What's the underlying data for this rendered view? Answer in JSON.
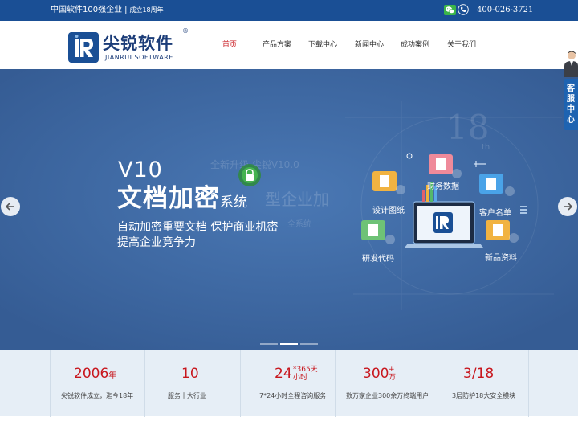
{
  "topbar": {
    "slogan": "中国软件100强企业",
    "divider": "|",
    "years": "成立18周年",
    "phone": "400-026-3721",
    "icons": {
      "wechat": "wechat-icon",
      "phone": "phone-icon"
    }
  },
  "header": {
    "logo_cn": "尖锐软件",
    "logo_en": "JIANRUI SOFTWARE",
    "registered": "®"
  },
  "nav": [
    {
      "label": "首页",
      "active": true
    },
    {
      "label": "产品方案",
      "active": false
    },
    {
      "label": "下载中心",
      "active": false
    },
    {
      "label": "新闻中心",
      "active": false
    },
    {
      "label": "成功案例",
      "active": false
    },
    {
      "label": "关于我们",
      "active": false
    }
  ],
  "hero": {
    "version": "V10",
    "title_main": "文档加密",
    "title_tail": "系统",
    "subtitle": "自动加密重要文档 保护商业机密",
    "subtitle2": "提高企业竞争力",
    "ghost_line1": "全新升级  尖锐V10.0",
    "ghost_line2": "型企业加",
    "ghost_line3": "全系统",
    "ghost_18": "18",
    "ghost_th": "th",
    "art_labels": {
      "finance": "财务数据",
      "design": "设计图纸",
      "customer": "客户名单",
      "code": "研发代码",
      "product": "新品资料"
    },
    "active_slide": 2,
    "slide_count": 3
  },
  "stats": [
    {
      "num": "2006",
      "unit": "年",
      "label": "尖锐软件成立，迄今18年"
    },
    {
      "num": "10",
      "unit": "",
      "label": "服务十大行业"
    },
    {
      "num": "24",
      "unit_top": "*365天",
      "unit_bottom": "小时",
      "label": "7*24小时全程咨询服务"
    },
    {
      "num": "300",
      "unit_top": "+",
      "unit_bottom": "万",
      "label": "数万家企业300余万终端用户"
    },
    {
      "num": "3/18",
      "unit": "",
      "label": "3层防护18大安全模块"
    }
  ],
  "service": {
    "tab_chars": [
      "客",
      "服",
      "中",
      "心"
    ]
  },
  "colors": {
    "topbar": "#1a4f95",
    "brand_navy": "#1b3c78",
    "nav_active": "#c8161d",
    "hero_bg": "#3f6aa4",
    "stat_red": "#c8161d",
    "stats_bg": "#e6eef6",
    "service_tab": "#1e63b1"
  }
}
